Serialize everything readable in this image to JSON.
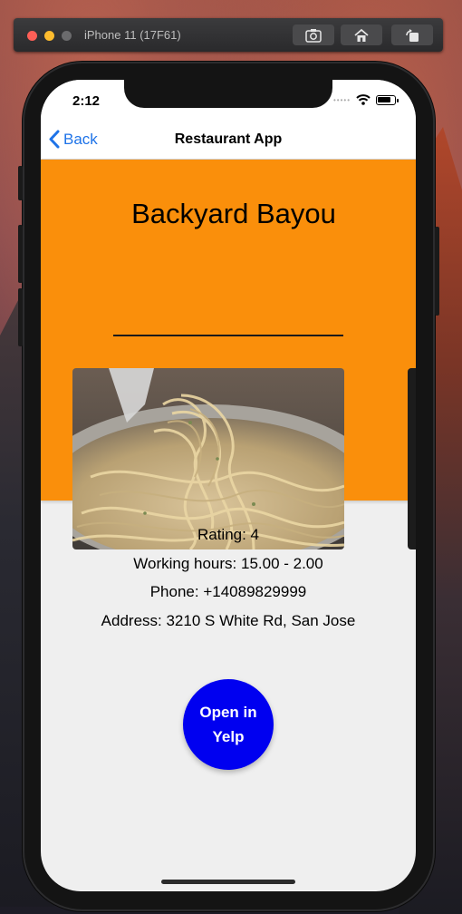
{
  "simulator": {
    "device_label": "iPhone 11 (17F61)",
    "buttons": [
      {
        "icon": "screenshot-icon"
      },
      {
        "icon": "home-icon"
      },
      {
        "icon": "rotate-icon"
      }
    ]
  },
  "status_bar": {
    "time": "2:12",
    "signal": "•••••",
    "wifi_icon": "wifi-icon",
    "battery_icon": "battery-icon"
  },
  "navbar": {
    "back_label": "Back",
    "title": "Restaurant App"
  },
  "restaurant": {
    "name": "Backyard Bayou",
    "accent_color": "#fa8f0b",
    "rating": "Rating: 4",
    "hours": "Working hours: 15.00 - 2.00",
    "phone": "Phone: +14089829999",
    "address": "Address: 3210 S White Rd, San Jose"
  },
  "actions": {
    "yelp_label": "Open in Yelp",
    "yelp_color": "#0000f0"
  }
}
